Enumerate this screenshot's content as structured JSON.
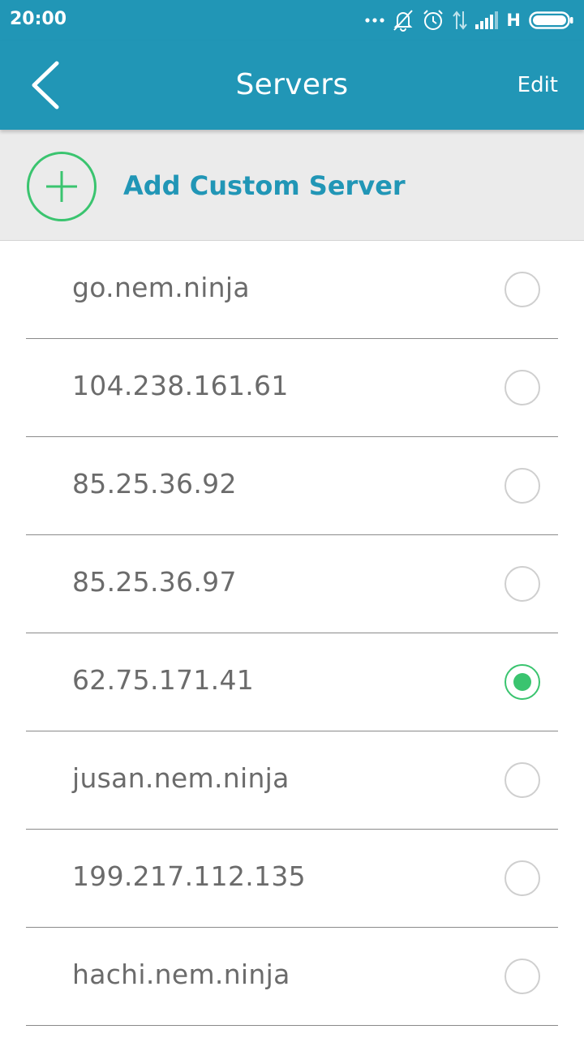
{
  "status_bar": {
    "time": "20:00",
    "network": "H",
    "icons": [
      "more-dots-icon",
      "muted-bell-icon",
      "alarm-icon",
      "data-arrows-icon",
      "signal-icon",
      "battery-icon"
    ]
  },
  "app_bar": {
    "back_icon": "chevron-left-icon",
    "title": "Servers",
    "edit_label": "Edit"
  },
  "add_server": {
    "icon": "plus-circle-icon",
    "label": "Add Custom Server"
  },
  "colors": {
    "primary": "#2196b6",
    "accent_green": "#3ac46f",
    "text_gray": "#6b6b6b",
    "header_bg": "#ebebeb"
  },
  "servers": [
    {
      "name": "go.nem.ninja",
      "selected": false
    },
    {
      "name": "104.238.161.61",
      "selected": false
    },
    {
      "name": "85.25.36.92",
      "selected": false
    },
    {
      "name": "85.25.36.97",
      "selected": false
    },
    {
      "name": "62.75.171.41",
      "selected": true
    },
    {
      "name": "jusan.nem.ninja",
      "selected": false
    },
    {
      "name": "199.217.112.135",
      "selected": false
    },
    {
      "name": "hachi.nem.ninja",
      "selected": false
    }
  ]
}
